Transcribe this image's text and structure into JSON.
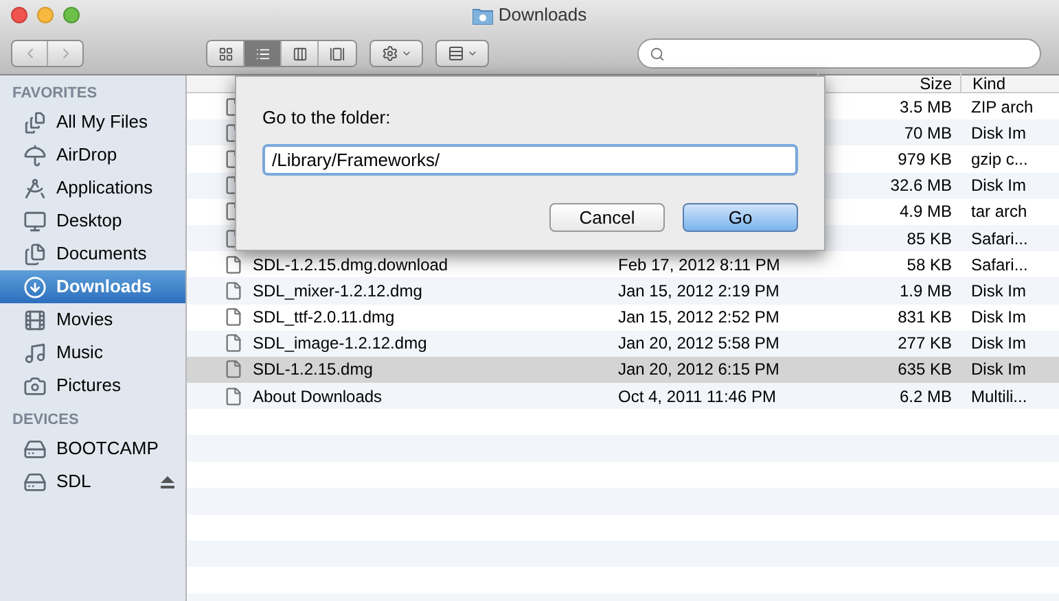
{
  "window": {
    "title": "Downloads"
  },
  "toolbar": {
    "view_modes": [
      {
        "selected": false
      },
      {
        "selected": true
      },
      {
        "selected": false
      },
      {
        "selected": false
      }
    ]
  },
  "sidebar": {
    "sections": [
      {
        "title": "FAVORITES",
        "items": [
          {
            "label": "All My Files",
            "selected": false
          },
          {
            "label": "AirDrop",
            "selected": false
          },
          {
            "label": "Applications",
            "selected": false
          },
          {
            "label": "Desktop",
            "selected": false
          },
          {
            "label": "Documents",
            "selected": false
          },
          {
            "label": "Downloads",
            "selected": true
          },
          {
            "label": "Movies",
            "selected": false
          },
          {
            "label": "Music",
            "selected": false
          },
          {
            "label": "Pictures",
            "selected": false
          }
        ]
      },
      {
        "title": "DEVICES",
        "items": [
          {
            "label": "BOOTCAMP",
            "selected": false,
            "ejectable": false
          },
          {
            "label": "SDL",
            "selected": false,
            "ejectable": true
          }
        ]
      }
    ]
  },
  "table": {
    "columns": [
      "Size",
      "Kind"
    ],
    "rows": [
      {
        "size": "3.5 MB",
        "kind": "ZIP arch",
        "selected": false
      },
      {
        "size": "70 MB",
        "kind": "Disk Im",
        "selected": false
      },
      {
        "size": "979 KB",
        "kind": "gzip c...",
        "selected": false
      },
      {
        "size": "32.6 MB",
        "kind": "Disk Im",
        "selected": false
      },
      {
        "size": "4.9 MB",
        "kind": "tar arch",
        "selected": false
      },
      {
        "size": "85 KB",
        "kind": "Safari...",
        "selected": false
      },
      {
        "name": "SDL-1.2.15.dmg.download",
        "date": "Feb 17, 2012 8:11 PM",
        "size": "58 KB",
        "kind": "Safari...",
        "selected": false
      },
      {
        "name": "SDL_mixer-1.2.12.dmg",
        "date": "Jan 15, 2012 2:19 PM",
        "size": "1.9 MB",
        "kind": "Disk Im",
        "selected": false
      },
      {
        "name": "SDL_ttf-2.0.11.dmg",
        "date": "Jan 15, 2012 2:52 PM",
        "size": "831 KB",
        "kind": "Disk Im",
        "selected": false
      },
      {
        "name": "SDL_image-1.2.12.dmg",
        "date": "Jan 20, 2012 5:58 PM",
        "size": "277 KB",
        "kind": "Disk Im",
        "selected": false
      },
      {
        "name": "SDL-1.2.15.dmg",
        "date": "Jan 20, 2012 6:15 PM",
        "size": "635 KB",
        "kind": "Disk Im",
        "selected": true
      },
      {
        "name": "About Downloads",
        "date": "Oct 4, 2011 11:46 PM",
        "size": "6.2 MB",
        "kind": "Multili...",
        "selected": false
      }
    ]
  },
  "dialog": {
    "label": "Go to the folder:",
    "value": "/Library/Frameworks/",
    "buttons": [
      {
        "label": "Cancel",
        "kind": "normal"
      },
      {
        "label": "Go",
        "kind": "default"
      }
    ]
  }
}
